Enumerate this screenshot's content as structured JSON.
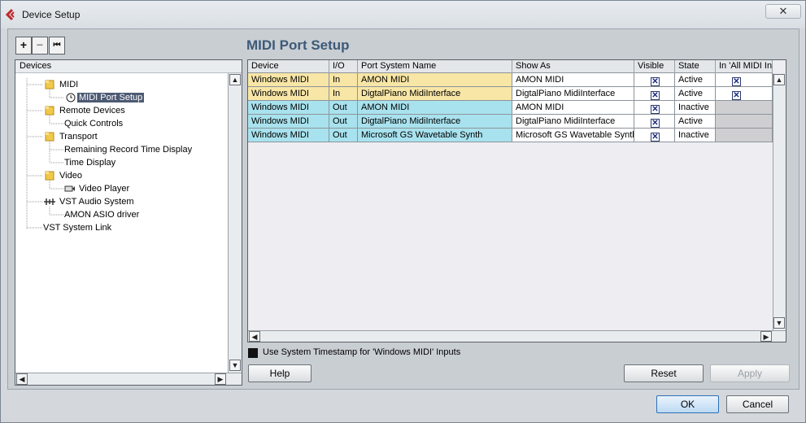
{
  "window": {
    "title": "Device Setup",
    "close_glyph": "✕"
  },
  "toolbar": {
    "add_glyph": "+",
    "remove_glyph": "−",
    "reset_glyph": "⏮"
  },
  "devices": {
    "header": "Devices",
    "tree": [
      {
        "label": "MIDI",
        "icon": "folder-icon"
      },
      {
        "label": "MIDI Port Setup",
        "icon": "clock-icon",
        "selected": true
      },
      {
        "label": "Remote Devices",
        "icon": "folder-icon"
      },
      {
        "label": "Quick Controls"
      },
      {
        "label": "Transport",
        "icon": "folder-icon"
      },
      {
        "label": "Remaining Record Time Display"
      },
      {
        "label": "Time Display"
      },
      {
        "label": "Video",
        "icon": "folder-icon"
      },
      {
        "label": "Video Player",
        "icon": "video-icon"
      },
      {
        "label": "VST Audio System",
        "icon": "audio-icon"
      },
      {
        "label": "AMON ASIO driver"
      },
      {
        "label": "VST System Link"
      }
    ]
  },
  "main": {
    "section_title": "MIDI Port Setup",
    "columns": [
      "Device",
      "I/O",
      "Port System Name",
      "Show As",
      "Visible",
      "State",
      "In 'All MIDI In"
    ],
    "rows": [
      {
        "device": "Windows MIDI",
        "io": "In",
        "port": "AMON MIDI",
        "show_as": "AMON MIDI",
        "visible": true,
        "state": "Active",
        "all_midi": true,
        "color": "#f8e6a6"
      },
      {
        "device": "Windows MIDI",
        "io": "In",
        "port": "DigtalPiano MidiInterface",
        "show_as": "DigtalPiano MidiInterface",
        "visible": true,
        "state": "Active",
        "all_midi": true,
        "color": "#f8e6a6"
      },
      {
        "device": "Windows MIDI",
        "io": "Out",
        "port": "AMON MIDI",
        "show_as": "AMON MIDI",
        "visible": true,
        "state": "Inactive",
        "all_midi": null,
        "color": "#a8e2ee"
      },
      {
        "device": "Windows MIDI",
        "io": "Out",
        "port": "DigtalPiano MidiInterface",
        "show_as": "DigtalPiano MidiInterface",
        "visible": true,
        "state": "Active",
        "all_midi": null,
        "color": "#a8e2ee"
      },
      {
        "device": "Windows MIDI",
        "io": "Out",
        "port": "Microsoft GS Wavetable Synth",
        "show_as": "Microsoft GS Wavetable Synth",
        "visible": true,
        "state": "Inactive",
        "all_midi": null,
        "color": "#a8e2ee"
      }
    ],
    "check_glyph": "✕",
    "timestamp_option": "Use System Timestamp for 'Windows MIDI' Inputs"
  },
  "buttons": {
    "help": "Help",
    "reset": "Reset",
    "apply": "Apply",
    "ok": "OK",
    "cancel": "Cancel"
  },
  "scroll": {
    "up": "▲",
    "down": "▼",
    "left": "◀",
    "right": "▶"
  }
}
